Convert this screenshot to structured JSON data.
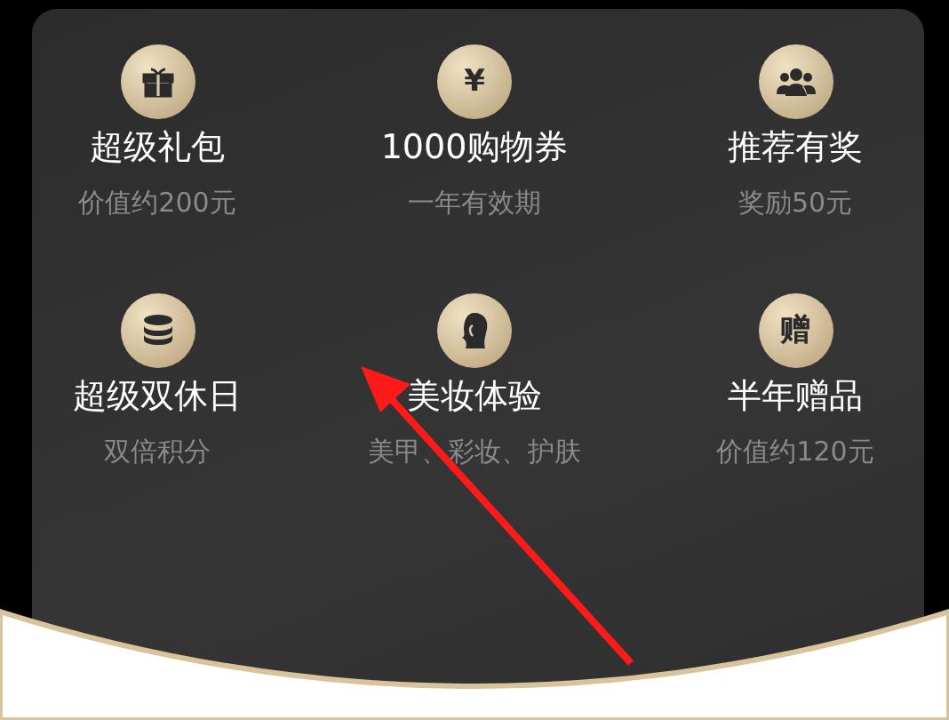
{
  "benefits": [
    {
      "kind": "gift",
      "title": "超级礼包",
      "subtitle": "价值约200元"
    },
    {
      "kind": "glyph",
      "glyph": "¥",
      "title": "1000购物券",
      "subtitle": "一年有效期"
    },
    {
      "kind": "people",
      "title": "推荐有奖",
      "subtitle": "奖励50元"
    },
    {
      "kind": "coins",
      "title": "超级双休日",
      "subtitle": "双倍积分"
    },
    {
      "kind": "face",
      "title": "美妆体验",
      "subtitle": "美甲、彩妆、护肤"
    },
    {
      "kind": "glyph",
      "glyph": "赠",
      "title": "半年赠品",
      "subtitle": "价值约120元"
    }
  ]
}
